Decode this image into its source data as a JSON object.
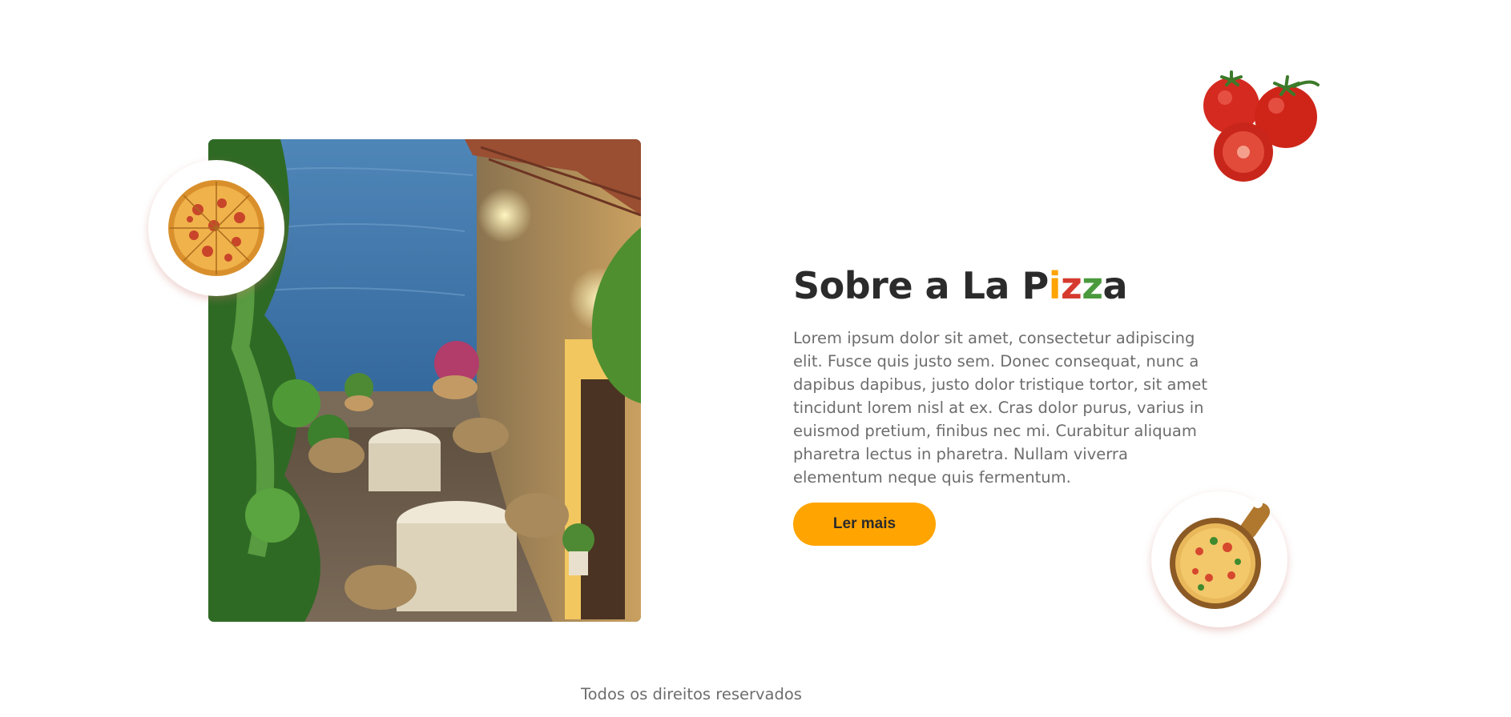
{
  "about": {
    "title_parts": [
      {
        "text": "Sobre a La P",
        "color": "#2b2b2b"
      },
      {
        "text": "i",
        "color": "#ffa400"
      },
      {
        "text": "z",
        "color": "#d63a2f"
      },
      {
        "text": "z",
        "color": "#4a9a3d"
      },
      {
        "text": "a",
        "color": "#2b2b2b"
      }
    ],
    "body": "Lorem ipsum dolor sit amet, consectetur adipiscing elit. Fusce quis justo sem. Donec consequat, nunc a dapibus dapibus, justo dolor tristique tortor, sit amet tincidunt lorem nisl at ex. Cras dolor purus, varius in euismod pretium, finibus nec mi. Curabitur aliquam pharetra lectus in pharetra. Nullam viverra elementum neque quis fermentum.",
    "button_label": "Ler mais"
  },
  "images": {
    "main_photo": "restaurant-terrace-photo",
    "top_left_badge": "pizza-icon",
    "top_right": "tomatoes-icon",
    "bottom_right_badge": "pizza-board-icon"
  },
  "colors": {
    "accent": "#ffa400",
    "heading": "#2b2b2b",
    "text": "#6d6d6d"
  },
  "footer": {
    "text": "Todos os direitos reservados"
  }
}
